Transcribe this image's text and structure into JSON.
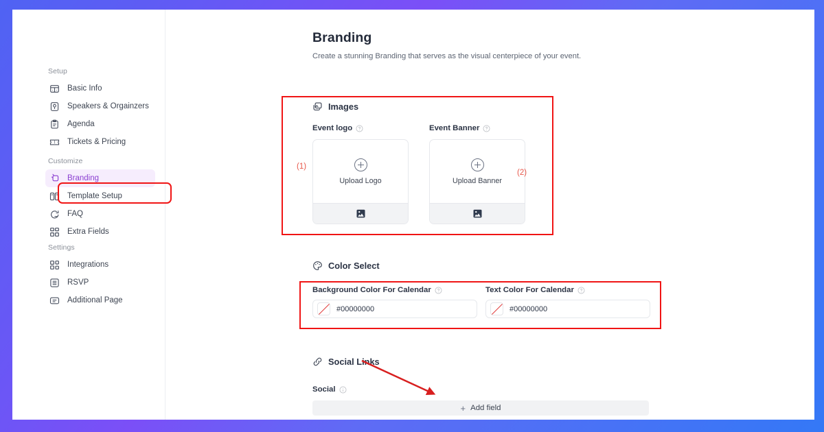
{
  "window": {
    "border_gradient_from": "#4f63f3",
    "border_gradient_mid": "#7b4ff7",
    "border_gradient_to": "#3478f6",
    "annotation_color": "#f01414"
  },
  "sidebar": {
    "groups": [
      {
        "label": "Setup",
        "items": [
          {
            "label": "Basic Info",
            "icon": "grid-layout-icon",
            "active": false
          },
          {
            "label": "Speakers & Orgainzers",
            "icon": "microphone-box-icon",
            "active": false
          },
          {
            "label": "Agenda",
            "icon": "clipboard-icon",
            "active": false
          },
          {
            "label": "Tickets & Pricing",
            "icon": "ticket-icon",
            "active": false
          }
        ]
      },
      {
        "label": "Customize",
        "items": [
          {
            "label": "Branding",
            "icon": "branding-tag-icon",
            "active": true
          },
          {
            "label": "Template Setup",
            "icon": "template-icon",
            "active": false
          },
          {
            "label": "FAQ",
            "icon": "faq-chat-icon",
            "active": false
          },
          {
            "label": "Extra Fields",
            "icon": "extra-fields-icon",
            "active": false
          }
        ]
      },
      {
        "label": "Settings",
        "items": [
          {
            "label": "Integrations",
            "icon": "integrations-icon",
            "active": false
          },
          {
            "label": "RSVP",
            "icon": "list-box-icon",
            "active": false
          },
          {
            "label": "Additional Page",
            "icon": "additional-page-icon",
            "active": false
          }
        ]
      }
    ]
  },
  "page": {
    "title": "Branding",
    "subtitle": "Create a stunning Branding that serves as the visual centerpiece of your event."
  },
  "images_section": {
    "heading": "Images",
    "heading_icon": "images-layers-icon",
    "logo": {
      "label": "Event logo",
      "help_icon": "help-circle-icon",
      "upload_text": "Upload Logo",
      "plus_icon": "plus-circle-icon",
      "footer_icon": "picture-icon"
    },
    "banner": {
      "label": "Event Banner",
      "help_icon": "help-circle-icon",
      "upload_text": "Upload Banner",
      "plus_icon": "plus-circle-icon",
      "footer_icon": "picture-icon"
    }
  },
  "color_section": {
    "heading": "Color Select",
    "heading_icon": "color-palette-icon",
    "background_color": {
      "label": "Background Color For Calendar",
      "help_icon": "help-circle-icon",
      "value": "#00000000",
      "swatch_icon": "transparent-swatch-icon"
    },
    "text_color": {
      "label": "Text Color For Calendar",
      "help_icon": "help-circle-icon",
      "value": "#00000000",
      "swatch_icon": "transparent-swatch-icon"
    }
  },
  "social_section": {
    "heading": "Social Links",
    "heading_icon": "link-chain-icon",
    "field_label": "Social",
    "info_icon": "info-circle-icon",
    "add_field_label": "Add field",
    "add_field_plus": "+"
  },
  "annotations": {
    "marker_1": "(1)",
    "marker_2": "(2)"
  }
}
